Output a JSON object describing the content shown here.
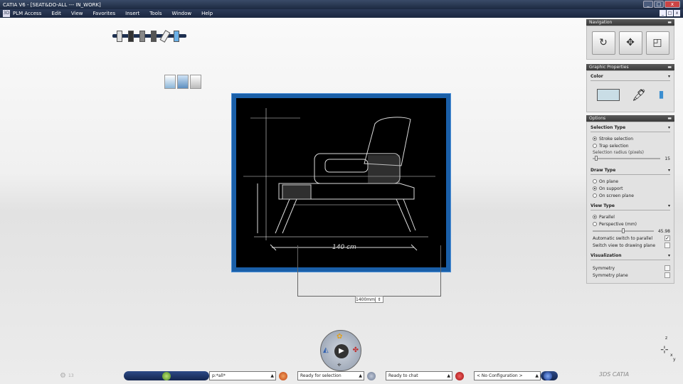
{
  "window": {
    "title": "CATIA V6 - [SEAT&DO-ALL --- IN_WORK]",
    "controls": [
      "_",
      "□",
      "x"
    ],
    "mdi_controls": [
      "_",
      "□",
      "x"
    ]
  },
  "menu": {
    "items": [
      "PLM Access",
      "Edit",
      "View",
      "Favorites",
      "Insert",
      "Tools",
      "Window",
      "Help"
    ]
  },
  "sketch": {
    "dimension_value": "1400mm",
    "annotation": "140 cm"
  },
  "navigation": {
    "header": "Navigation",
    "buttons": [
      {
        "icon": "rotate-icon",
        "glyph": "↻"
      },
      {
        "icon": "pan-icon",
        "glyph": "✥"
      },
      {
        "icon": "fit-all-icon",
        "glyph": "◰"
      }
    ]
  },
  "graphic_properties": {
    "header": "Graphic Properties",
    "color_label": "Color",
    "swatch_color": "#c9dde6"
  },
  "options": {
    "header": "Options",
    "selection_type": {
      "label": "Selection Type",
      "choices": [
        "Stroke selection",
        "Trap selection"
      ],
      "selected": 0,
      "radius_label": "Selection radius (pixels)",
      "radius_value": "15",
      "radius_fraction": 0.03
    },
    "draw_type": {
      "label": "Draw Type",
      "choices": [
        "On plane",
        "On support",
        "On screen plane"
      ],
      "selected": 1
    },
    "view_type": {
      "label": "View Type",
      "choices": [
        "Parallel",
        "Perspective (mm)"
      ],
      "selected": 0,
      "perspective_value": "45.98",
      "perspective_fraction": 0.48,
      "checks": [
        {
          "label": "Automatic switch to parallel",
          "checked": true
        },
        {
          "label": "Switch view to drawing plane",
          "checked": false
        }
      ]
    },
    "visualization": {
      "label": "Visualization",
      "checks": [
        {
          "label": "Symmetry",
          "checked": false
        },
        {
          "label": "Symmetry plane",
          "checked": false
        }
      ]
    }
  },
  "statusbar": {
    "filter": "p:*all*",
    "selection_status": "Ready for selection",
    "chat_status": "Ready to chat",
    "configuration": "< No Configuration >",
    "left_count": "13"
  },
  "compass": {
    "z": "z",
    "x": "x",
    "y": "y"
  }
}
